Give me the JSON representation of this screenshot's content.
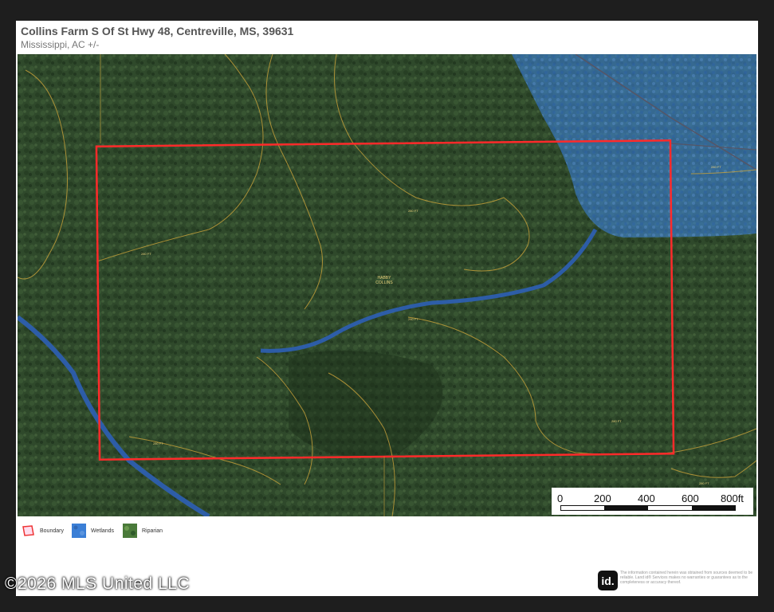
{
  "header": {
    "title": "Collins Farm S Of St Hwy 48, Centreville, MS, 39631",
    "subtitle": "Mississippi,  AC +/-"
  },
  "map": {
    "owner_label_line1": "HABBY",
    "owner_label_line2": "COLLINS",
    "contour_label": "280 FT",
    "colors": {
      "boundary": "#ff2a2a",
      "wetlands": "#3b7fd6",
      "stream": "#2d5fb5",
      "contour": "#c9a23a",
      "forest": "#2f4a2a"
    }
  },
  "scale": {
    "ticks": [
      "0",
      "200",
      "400",
      "600",
      "800ft"
    ]
  },
  "legend": {
    "items": [
      {
        "label": "Boundary",
        "icon": "boundary-icon"
      },
      {
        "label": "Wetlands",
        "icon": "wetlands-icon"
      },
      {
        "label": "Riparian",
        "icon": "riparian-icon"
      }
    ]
  },
  "footer": {
    "logo": "id.",
    "disclaimer": "The information contained herein was obtained from sources deemed to be reliable. Land id® Services makes no warranties or guarantees as to the completeness or accuracy thereof."
  },
  "watermark": "©2026 MLS United LLC"
}
